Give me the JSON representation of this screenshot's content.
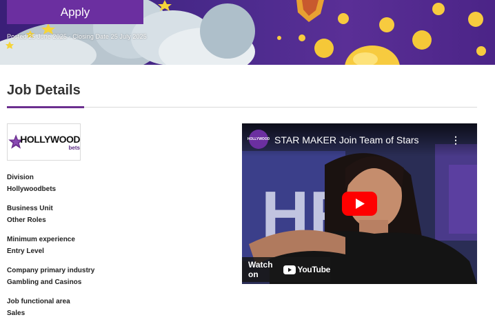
{
  "banner": {
    "apply_label": "Apply",
    "dates_text": "Posted 25 June 2025 - Closing Date 25 July 2025"
  },
  "section": {
    "title": "Job Details"
  },
  "logo": {
    "name": "HOLLYWOOD",
    "sub": "bets"
  },
  "details": [
    {
      "label": "Division",
      "value": "Hollywoodbets"
    },
    {
      "label": "Business Unit",
      "value": "Other Roles"
    },
    {
      "label": "Minimum experience",
      "value": "Entry Level"
    },
    {
      "label": "Company primary industry",
      "value": "Gambling and Casinos"
    },
    {
      "label": "Job functional area",
      "value": "Sales"
    }
  ],
  "video": {
    "title": "STAR MAKER Join Team of Stars",
    "channel_avatar_text": "HOLLYWOOD",
    "watch_on_label": "Watch on",
    "youtube_label": "YouTube",
    "wall_letters": "HR"
  },
  "colors": {
    "brand_purple": "#6b2fa0",
    "banner_bg": "#4a2a8c",
    "accent_rule": "#6b2f8f",
    "youtube_red": "#ff0000"
  }
}
